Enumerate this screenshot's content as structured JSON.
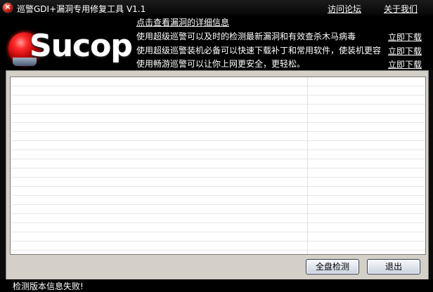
{
  "window": {
    "title": "巡警GDI+漏洞专用修复工具 V1.1",
    "links": [
      {
        "label": "访问论坛"
      },
      {
        "label": "关于我们"
      }
    ]
  },
  "header": {
    "logo_text": "Sucop",
    "details_link": "点击查看漏洞的详细信息",
    "promos": [
      {
        "text": "使用超级巡警可以及时的检测最新漏洞和有效查杀木马病毒",
        "link": "立即下载"
      },
      {
        "text": "使用超级巡警装机必备可以快速下载补丁和常用软件，使装机更容",
        "link": "立即下载"
      },
      {
        "text": "使用畅游巡警可以让你上网更安全，更轻松。",
        "link": "立即下载"
      }
    ]
  },
  "results_list": {
    "rows": []
  },
  "buttons": {
    "scan_all": "全盘检测",
    "exit": "退出"
  },
  "status": {
    "text": "检测版本信息失败!"
  },
  "colors": {
    "background": "#000000",
    "panel": "#d4d0c8",
    "accent": "#c0180c"
  }
}
